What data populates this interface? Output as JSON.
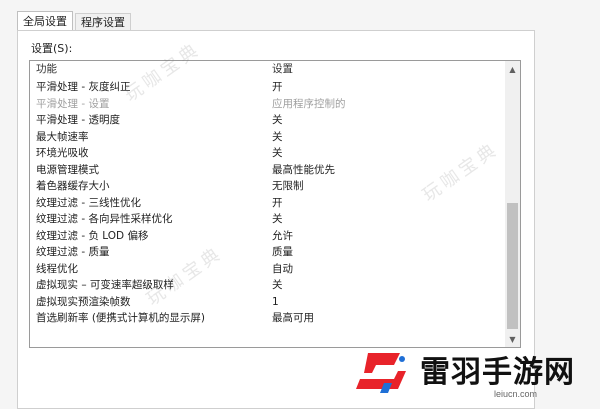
{
  "tabs": [
    {
      "label": "全局设置",
      "active": true
    },
    {
      "label": "程序设置",
      "active": false
    }
  ],
  "settings_label": "设置(S):",
  "table": {
    "columns": [
      "功能",
      "设置"
    ],
    "rows": [
      {
        "feature": "平滑处理 - 灰度纠正",
        "value": "开",
        "disabled": false
      },
      {
        "feature": "平滑处理 - 设置",
        "value": "应用程序控制的",
        "disabled": true
      },
      {
        "feature": "平滑处理 - 透明度",
        "value": "关",
        "disabled": false
      },
      {
        "feature": "最大帧速率",
        "value": "关",
        "disabled": false
      },
      {
        "feature": "环境光吸收",
        "value": "关",
        "disabled": false
      },
      {
        "feature": "电源管理模式",
        "value": "最高性能优先",
        "disabled": false
      },
      {
        "feature": "着色器缓存大小",
        "value": "无限制",
        "disabled": false
      },
      {
        "feature": "纹理过滤 - 三线性优化",
        "value": "开",
        "disabled": false
      },
      {
        "feature": "纹理过滤 - 各向异性采样优化",
        "value": "关",
        "disabled": false
      },
      {
        "feature": "纹理过滤 - 负 LOD 偏移",
        "value": "允许",
        "disabled": false
      },
      {
        "feature": "纹理过滤 - 质量",
        "value": "质量",
        "disabled": false
      },
      {
        "feature": "线程优化",
        "value": "自动",
        "disabled": false
      },
      {
        "feature": "虚拟现实 – 可变速率超级取样",
        "value": "关",
        "disabled": false
      },
      {
        "feature": "虚拟现实预渲染帧数",
        "value": "1",
        "disabled": false
      },
      {
        "feature": "首选刷新率 (便携式计算机的显示屏)",
        "value": "最高可用",
        "disabled": false
      }
    ]
  },
  "watermark_text": "玩咖宝典",
  "logo": {
    "name": "雷羽手游网",
    "url": "leiucn.com",
    "colors": {
      "red": "#e8232a",
      "blue": "#1f6fd6"
    }
  },
  "icons": {
    "scroll_up": "scroll-up-arrow-icon",
    "scroll_down": "scroll-down-arrow-icon"
  }
}
